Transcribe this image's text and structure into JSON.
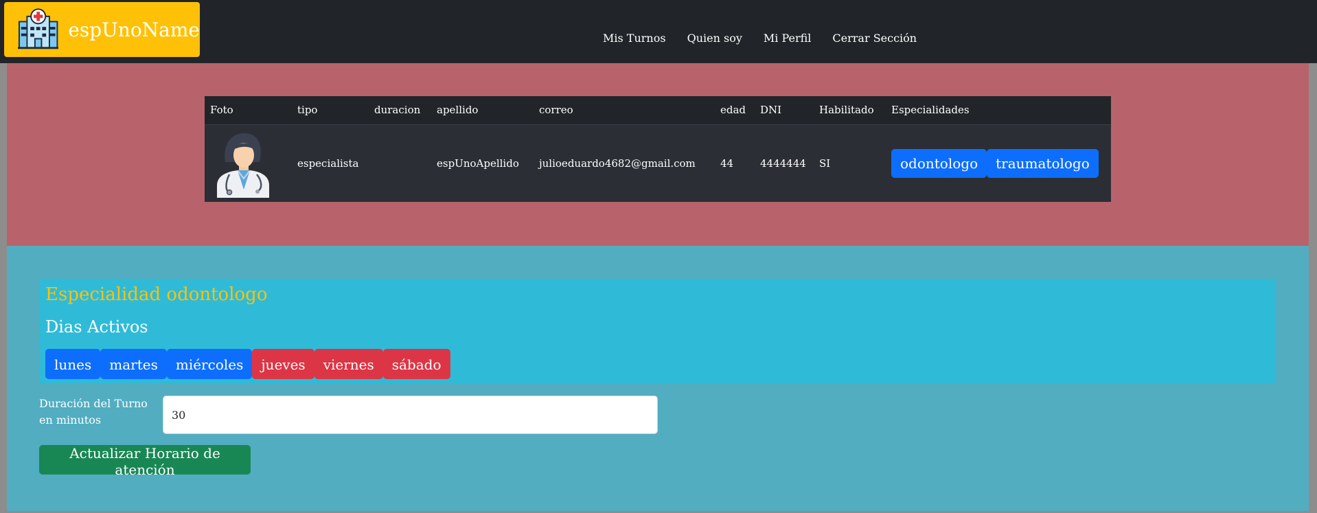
{
  "navbar": {
    "brand_name": "espUnoName",
    "links": [
      "Mis Turnos",
      "Quien soy",
      "Mi Perfil",
      "Cerrar Sección"
    ]
  },
  "user_table": {
    "headers": [
      "Foto",
      "tipo",
      "duracion",
      "apellido",
      "correo",
      "edad",
      "DNI",
      "Habilitado",
      "Especialidades"
    ],
    "row": {
      "tipo": "especialista",
      "duracion": "",
      "apellido": "espUnoApellido",
      "correo": "julioeduardo4682@gmail.com",
      "edad": "44",
      "dni": "4444444",
      "habilitado": "SI",
      "especialidades": [
        "odontologo",
        "traumatologo"
      ]
    }
  },
  "specialty_panel": {
    "title": "Especialidad odontologo",
    "dias_title": "Dias Activos",
    "days": [
      {
        "label": "lunes",
        "active": true
      },
      {
        "label": "martes",
        "active": true
      },
      {
        "label": "miércoles",
        "active": true
      },
      {
        "label": "jueves",
        "active": false
      },
      {
        "label": "viernes",
        "active": false
      },
      {
        "label": "sábado",
        "active": false
      }
    ]
  },
  "form": {
    "duration_label": "Duración del Turno en minutos",
    "duration_value": "30",
    "update_button": "Actualizar Horario de atención"
  },
  "colors": {
    "navbar": "#212529",
    "brand": "#ffc107",
    "top_section": "#b8636c",
    "bottom_section": "#52adc1",
    "panel": "#2fbbd8",
    "active_day": "#0d6efd",
    "inactive_day": "#dc3545",
    "update_button": "#198754"
  }
}
